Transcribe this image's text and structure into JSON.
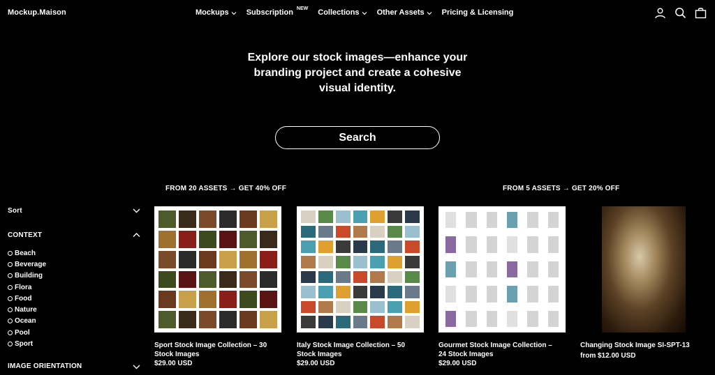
{
  "header": {
    "logo": "Mockup.Maison",
    "nav": [
      {
        "label": "Mockups",
        "dropdown": true,
        "badge": ""
      },
      {
        "label": "Subscription",
        "dropdown": false,
        "badge": "NEW"
      },
      {
        "label": "Collections",
        "dropdown": true,
        "badge": ""
      },
      {
        "label": "Other Assets",
        "dropdown": true,
        "badge": ""
      },
      {
        "label": "Pricing & Licensing",
        "dropdown": false,
        "badge": ""
      }
    ],
    "icons": [
      "account-icon",
      "search-icon",
      "cart-icon"
    ]
  },
  "hero": {
    "line1": "Explore our stock images—enhance your",
    "line2": "branding project and create a cohesive",
    "line3": "visual identity.",
    "search_label": "Search"
  },
  "promos": {
    "left": "FROM 20 ASSETS → GET 40% OFF",
    "right": "FROM 5 ASSETS → GET 20% OFF"
  },
  "sidebar": {
    "sort_label": "Sort",
    "context_label": "CONTEXT",
    "context_items": [
      "Beach",
      "Beverage",
      "Building",
      "Flora",
      "Food",
      "Nature",
      "Ocean",
      "Pool",
      "Sport"
    ],
    "orientation_label": "IMAGE ORIENTATION"
  },
  "products": [
    {
      "title_line1": "Sport Stock Image Collection – 30",
      "title_line2": "Stock Images",
      "price": "$29.00 USD"
    },
    {
      "title_line1": "Italy Stock Image Collection – 50",
      "title_line2": "Stock Images",
      "price": "$29.00 USD"
    },
    {
      "title_line1": "Gourmet Stock Image Collection –",
      "title_line2": "24 Stock Images",
      "price": "$29.00 USD"
    },
    {
      "title_line1": "Changing Stock Image SI-SPT-13",
      "title_line2": "",
      "price": "from $12.00 USD"
    }
  ],
  "colors": {
    "background": "#000000",
    "text": "#ffffff",
    "thumb_bg": "#ffffff"
  }
}
